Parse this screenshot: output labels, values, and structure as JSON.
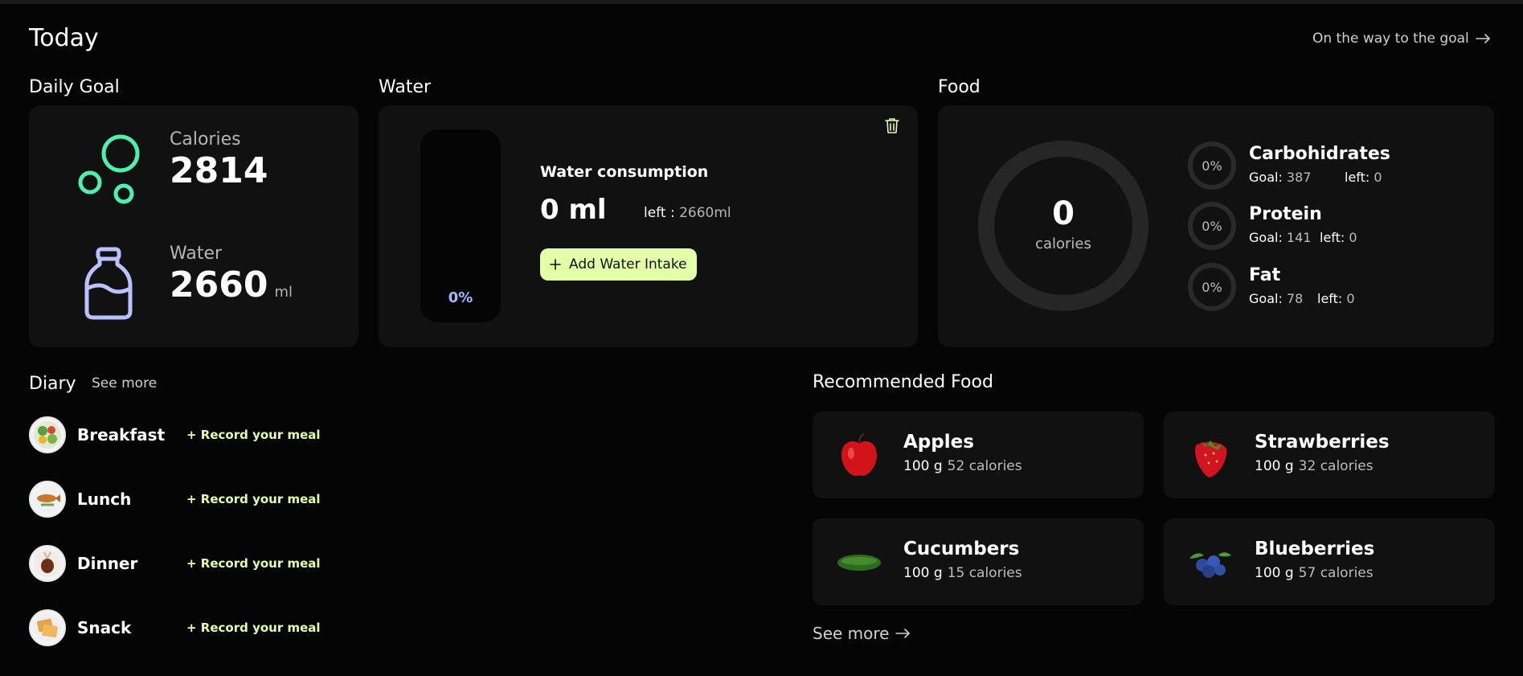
{
  "header": {
    "title": "Today",
    "goal_link": "On the way to the goal"
  },
  "daily_goal": {
    "heading": "Daily Goal",
    "calories_label": "Calories",
    "calories_value": "2814",
    "water_label": "Water",
    "water_value": "2660",
    "water_unit": "ml",
    "colors": {
      "calories_icon": "#4ef0b0",
      "water_icon": "#b9c2ff"
    }
  },
  "water": {
    "heading": "Water",
    "fill_percent_label": "0%",
    "fill_fraction": 0,
    "title": "Water consumption",
    "amount": "0 ml",
    "left_label": "left :",
    "left_value": "2660ml",
    "add_button": "Add Water Intake"
  },
  "food": {
    "heading": "Food",
    "calories_value": "0",
    "calories_label": "calories",
    "macros": [
      {
        "name": "Carbohidrates",
        "pct": "0%",
        "goal_label": "Goal:",
        "goal": "387",
        "left_label": "left:",
        "left": "0"
      },
      {
        "name": "Protein",
        "pct": "0%",
        "goal_label": "Goal:",
        "goal": "141",
        "left_label": "left:",
        "left": "0"
      },
      {
        "name": "Fat",
        "pct": "0%",
        "goal_label": "Goal:",
        "goal": "78",
        "left_label": "left:",
        "left": "0"
      }
    ]
  },
  "diary": {
    "heading": "Diary",
    "see_more": "See more",
    "record_label": "+ Record your meal",
    "meals": [
      {
        "name": "Breakfast",
        "icon": "salad-icon"
      },
      {
        "name": "Lunch",
        "icon": "fish-icon"
      },
      {
        "name": "Dinner",
        "icon": "roast-icon"
      },
      {
        "name": "Snack",
        "icon": "crackers-icon"
      }
    ]
  },
  "recommended": {
    "heading": "Recommended Food",
    "see_more": "See more",
    "items": [
      {
        "name": "Apples",
        "amount": "100 g",
        "calories": "52 calories",
        "icon": "apple-icon"
      },
      {
        "name": "Strawberries",
        "amount": "100 g",
        "calories": "32 calories",
        "icon": "strawberry-icon"
      },
      {
        "name": "Cucumbers",
        "amount": "100 g",
        "calories": "15 calories",
        "icon": "cucumber-icon"
      },
      {
        "name": "Blueberries",
        "amount": "100 g",
        "calories": "57 calories",
        "icon": "blueberry-icon"
      }
    ]
  },
  "accent": {
    "lime": "#e3ffa8",
    "lavender": "#a7b4ff",
    "card": "#111111",
    "bg": "#050505"
  }
}
